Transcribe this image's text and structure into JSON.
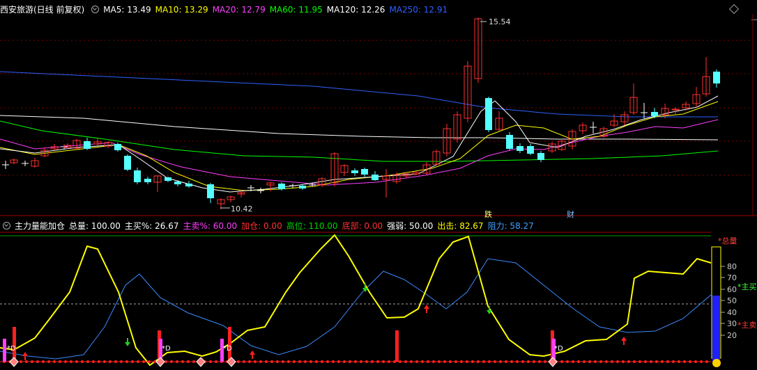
{
  "main_header": {
    "title": "西安旅游(日线 前复权)",
    "ma": [
      {
        "label": "MA5: 13.49",
        "color": "#ffffff"
      },
      {
        "label": "MA10: 13.29",
        "color": "#ffff00"
      },
      {
        "label": "MA20: 12.79",
        "color": "#ff40ff"
      },
      {
        "label": "MA60: 11.95",
        "color": "#00ff00"
      },
      {
        "label": "MA120: 12.26",
        "color": "#ffffff"
      },
      {
        "label": "MA250: 12.91",
        "color": "#3060ff"
      }
    ]
  },
  "price_annotations": {
    "high": "15.54",
    "low": "10.42",
    "event1": "跌",
    "event2": "财"
  },
  "indicator_header": {
    "name": "主力量能加仓",
    "fields": [
      {
        "label": "总量: 100.00",
        "color": "#ffffff"
      },
      {
        "label": "主买%: 26.67",
        "color": "#ffffff"
      },
      {
        "label": "主卖%: 60.00",
        "color": "#ff40ff"
      },
      {
        "label": "加仓: 0.00",
        "color": "#ff3030"
      },
      {
        "label": "高位: 110.00",
        "color": "#00d000"
      },
      {
        "label": "底部: 0.00",
        "color": "#ff3030"
      },
      {
        "label": "强弱: 50.00",
        "color": "#ffffff"
      },
      {
        "label": "出击: 82.67",
        "color": "#ffff00"
      },
      {
        "label": "阻力: 58.27",
        "color": "#40a0ff"
      }
    ]
  },
  "indicator_axis": {
    "ticks": [
      "80",
      "70",
      "60",
      "50",
      "40",
      "30",
      "20"
    ],
    "legend_total": "*总量",
    "legend_buy": "*主买",
    "legend_sell": "*主卖",
    "marker_d": "*D"
  },
  "colors": {
    "up": "#ff3030",
    "down": "#54ffff",
    "ma5": "#ffffff",
    "ma10": "#ffff00",
    "ma20": "#ff40ff",
    "ma60": "#00ff00",
    "ma120": "#ffffff",
    "ma250": "#3060ff",
    "grid": "#800000"
  }
}
